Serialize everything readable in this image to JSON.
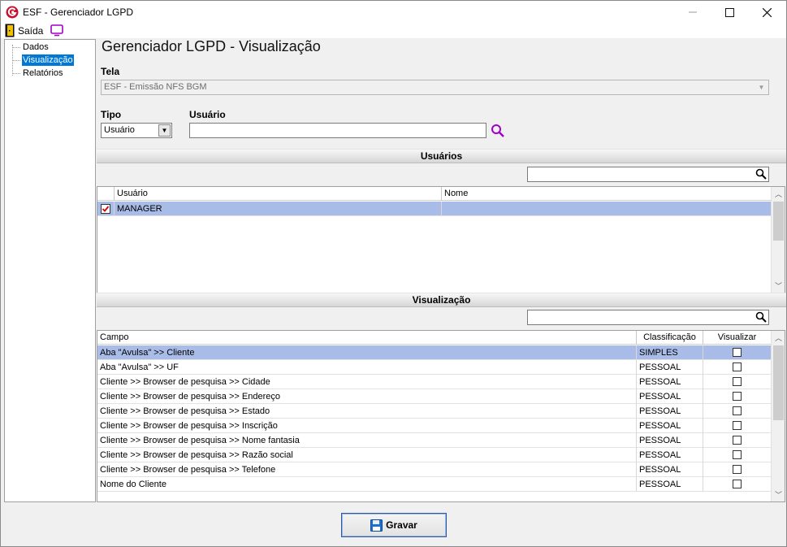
{
  "window": {
    "title": "ESF - Gerenciador LGPD"
  },
  "menu": {
    "exit_label": "Saída"
  },
  "sidebar": {
    "items": [
      {
        "label": "Dados"
      },
      {
        "label": "Visualização"
      },
      {
        "label": "Relatórios"
      }
    ]
  },
  "main": {
    "title": "Gerenciador LGPD - Visualização",
    "tela_label": "Tela",
    "tela_value": "ESF - Emissão NFS BGM",
    "tipo_label": "Tipo",
    "tipo_value": "Usuário",
    "usuario_label": "Usuário",
    "usuario_value": ""
  },
  "users_section": {
    "title": "Usuários",
    "filter_value": "",
    "columns": [
      "Usuário",
      "Nome"
    ],
    "rows": [
      {
        "checked": true,
        "usuario": "MANAGER",
        "nome": ""
      }
    ]
  },
  "view_section": {
    "title": "Visualização",
    "filter_value": "",
    "columns": [
      "Campo",
      "Classificação",
      "Visualizar"
    ],
    "rows": [
      {
        "campo": "Aba \"Avulsa\" >> Cliente",
        "classificacao": "SIMPLES",
        "visualizar": false
      },
      {
        "campo": "Aba \"Avulsa\" >> UF",
        "classificacao": "PESSOAL",
        "visualizar": false
      },
      {
        "campo": "Cliente >> Browser de pesquisa >> Cidade",
        "classificacao": "PESSOAL",
        "visualizar": false
      },
      {
        "campo": "Cliente >> Browser de pesquisa >> Endereço",
        "classificacao": "PESSOAL",
        "visualizar": false
      },
      {
        "campo": "Cliente >> Browser de pesquisa >> Estado",
        "classificacao": "PESSOAL",
        "visualizar": false
      },
      {
        "campo": "Cliente >> Browser de pesquisa >> Inscrição",
        "classificacao": "PESSOAL",
        "visualizar": false
      },
      {
        "campo": "Cliente >> Browser de pesquisa >> Nome fantasia",
        "classificacao": "PESSOAL",
        "visualizar": false
      },
      {
        "campo": "Cliente >> Browser de pesquisa >> Razão social",
        "classificacao": "PESSOAL",
        "visualizar": false
      },
      {
        "campo": "Cliente >> Browser de pesquisa >> Telefone",
        "classificacao": "PESSOAL",
        "visualizar": false
      },
      {
        "campo": "Nome do Cliente",
        "classificacao": "PESSOAL",
        "visualizar": false
      }
    ]
  },
  "footer": {
    "save_label": "Gravar"
  },
  "colors": {
    "selection": "#a9bce8",
    "tree_selection": "#0078d7",
    "brand_red": "#c8102e",
    "accent_purple": "#a000c8"
  }
}
